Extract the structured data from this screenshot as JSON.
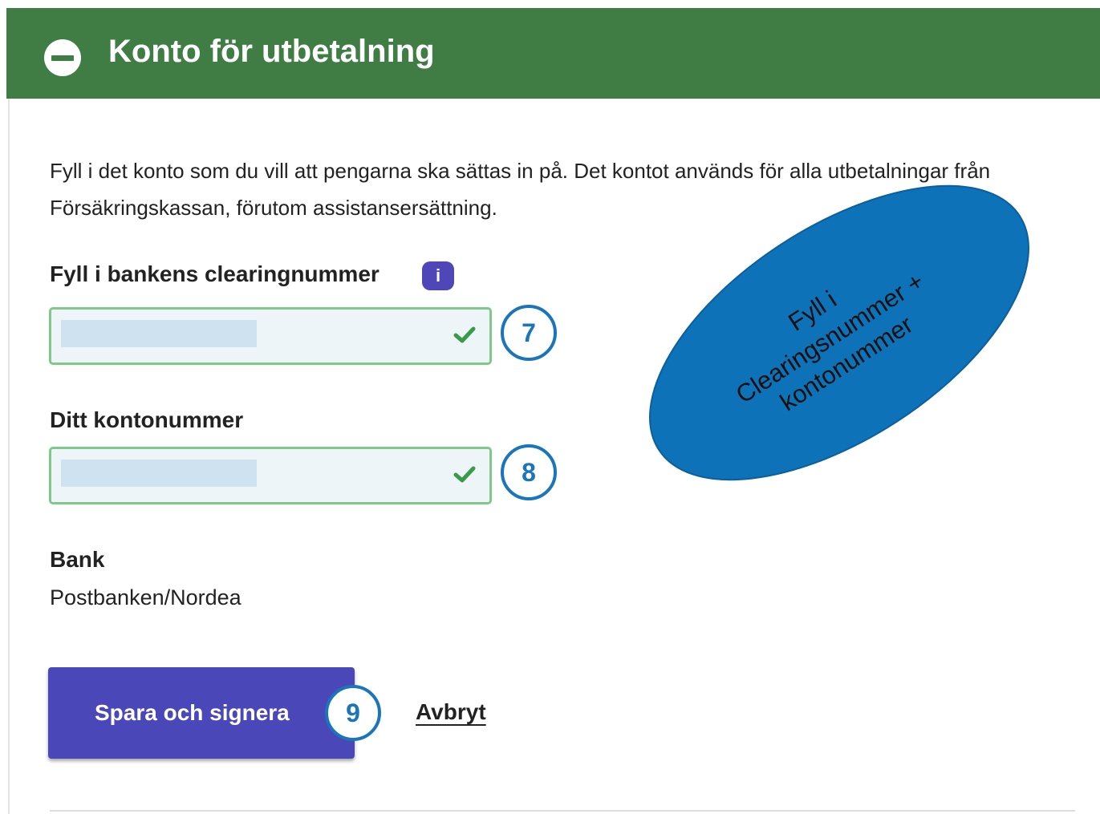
{
  "header": {
    "title": "Konto för utbetalning",
    "collapse_icon": "minus-circle-icon",
    "color": "#3f7d45"
  },
  "intro_text": "Fyll i det konto som du vill att pengarna ska sättas in på. Det kontot används för alla utbetalningar från Försäkringskassan, förutom assistansersättning.",
  "clearing": {
    "label": "Fyll i bankens clearingnummer",
    "info_icon": "info-icon",
    "info_glyph": "i",
    "value": "",
    "status_icon": "checkmark-icon"
  },
  "account": {
    "label": "Ditt kontonummer",
    "value": "",
    "status_icon": "checkmark-icon"
  },
  "bank": {
    "label": "Bank",
    "value": "Postbanken/Nordea"
  },
  "actions": {
    "save_label": "Spara och signera",
    "cancel_label": "Avbryt",
    "primary_color": "#4a47b9"
  },
  "markers": {
    "step7": "7",
    "step8": "8",
    "step9": "9",
    "color": "#1b75bb"
  },
  "callout": {
    "lines": [
      "Fyll i",
      "Clearingsnummer +",
      "kontonummer"
    ],
    "color": "#0d72b8"
  }
}
